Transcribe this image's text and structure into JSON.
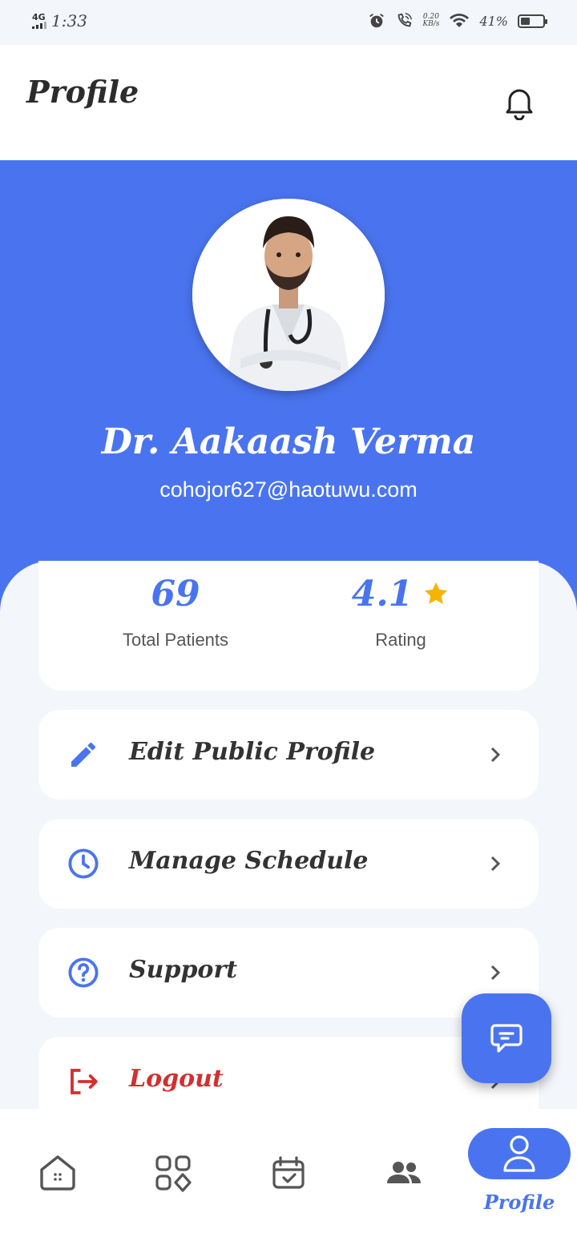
{
  "status_bar": {
    "network": "4G",
    "time": "1:33",
    "speed_value": "0.20",
    "speed_unit": "KB/s",
    "battery": "41%",
    "battery_level": 0.41
  },
  "header": {
    "title": "Profile"
  },
  "profile": {
    "name": "Dr. Aakaash Verma",
    "email": "cohojor627@haotuwu.com"
  },
  "stats": {
    "patients_value": "69",
    "patients_label": "Total Patients",
    "rating_value": "4.1",
    "rating_label": "Rating"
  },
  "menu": {
    "edit": "Edit Public Profile",
    "schedule": "Manage Schedule",
    "support": "Support",
    "logout": "Logout"
  },
  "bottom_nav": {
    "active_label": "Profile"
  },
  "colors": {
    "accent": "#4a74ef",
    "logout": "#d32f2f",
    "star": "#f5b400",
    "background": "#f3f6fa"
  }
}
